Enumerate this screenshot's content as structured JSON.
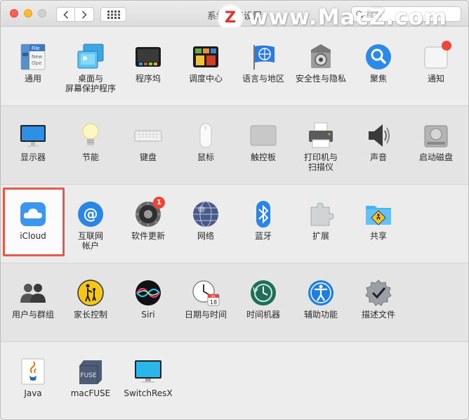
{
  "window": {
    "title": "系统偏好设置",
    "search_placeholder": "搜索"
  },
  "watermark": {
    "logo_letter": "Z",
    "text": "www.MacZ.com"
  },
  "sections": [
    {
      "panes": [
        {
          "label": "通用",
          "icon": "general-icon"
        },
        {
          "label": "桌面与\n屏幕保护程序",
          "icon": "desktop-screensaver-icon"
        },
        {
          "label": "程序坞",
          "icon": "dock-icon"
        },
        {
          "label": "调度中心",
          "icon": "mission-control-icon"
        },
        {
          "label": "语言与地区",
          "icon": "language-region-icon"
        },
        {
          "label": "安全性与隐私",
          "icon": "security-privacy-icon"
        },
        {
          "label": "聚焦",
          "icon": "spotlight-icon"
        },
        {
          "label": "通知",
          "icon": "notifications-icon"
        }
      ]
    },
    {
      "panes": [
        {
          "label": "显示器",
          "icon": "displays-icon"
        },
        {
          "label": "节能",
          "icon": "energy-saver-icon"
        },
        {
          "label": "键盘",
          "icon": "keyboard-icon"
        },
        {
          "label": "鼠标",
          "icon": "mouse-icon"
        },
        {
          "label": "触控板",
          "icon": "trackpad-icon"
        },
        {
          "label": "打印机与\n扫描仪",
          "icon": "printers-scanners-icon"
        },
        {
          "label": "声音",
          "icon": "sound-icon"
        },
        {
          "label": "启动磁盘",
          "icon": "startup-disk-icon"
        }
      ]
    },
    {
      "panes": [
        {
          "label": "iCloud",
          "icon": "icloud-icon"
        },
        {
          "label": "互联网\n帐户",
          "icon": "internet-accounts-icon"
        },
        {
          "label": "软件更新",
          "icon": "software-update-icon",
          "badge": "1"
        },
        {
          "label": "网络",
          "icon": "network-icon"
        },
        {
          "label": "蓝牙",
          "icon": "bluetooth-icon"
        },
        {
          "label": "扩展",
          "icon": "extensions-icon"
        },
        {
          "label": "共享",
          "icon": "sharing-icon"
        }
      ]
    },
    {
      "panes": [
        {
          "label": "用户与群组",
          "icon": "users-groups-icon"
        },
        {
          "label": "家长控制",
          "icon": "parental-controls-icon"
        },
        {
          "label": "Siri",
          "icon": "siri-icon"
        },
        {
          "label": "日期与时间",
          "icon": "date-time-icon"
        },
        {
          "label": "时间机器",
          "icon": "time-machine-icon"
        },
        {
          "label": "辅助功能",
          "icon": "accessibility-icon"
        },
        {
          "label": "描述文件",
          "icon": "profiles-icon"
        }
      ]
    },
    {
      "panes": [
        {
          "label": "Java",
          "icon": "java-icon"
        },
        {
          "label": "macFUSE",
          "icon": "macfuse-icon"
        },
        {
          "label": "SwitchResX",
          "icon": "switchresx-icon"
        }
      ]
    }
  ],
  "icon_text": {
    "general_file": "File",
    "general_new": "New",
    "general_open": "Ope",
    "calendar_month": "JUL",
    "calendar_day": "18",
    "macfuse": "FUSE"
  },
  "colors": {
    "highlight_border": "#e35a4b",
    "badge": "#f44336"
  }
}
